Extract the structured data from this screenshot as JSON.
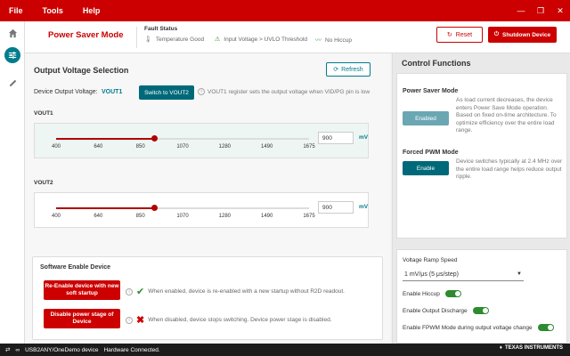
{
  "menu": {
    "file": "File",
    "tools": "Tools",
    "help": "Help"
  },
  "window": {
    "minimize": "—",
    "restore": "❐",
    "close": "✕"
  },
  "header": {
    "mode_title": "Power Saver Mode",
    "fault_title": "Fault Status",
    "faults": [
      {
        "label": "Temperature Good",
        "icon": "thermometer-icon"
      },
      {
        "label": "Input Voltage > UVLO Threshold",
        "icon": "warning-icon"
      },
      {
        "label": "No Hiccup",
        "icon": "wave-icon"
      }
    ],
    "reset_label": "Reset",
    "shutdown_label": "Shutdown Device"
  },
  "output": {
    "title": "Output Voltage Selection",
    "refresh_label": "Refresh",
    "device_output_label": "Device Output Voltage:",
    "device_output_value": "VOUT1",
    "switch_label": "Switch to VOUT2",
    "switch_note": "VOUT1 register sets the output voltage when VID/PG pin is low",
    "ticks": [
      "400",
      "640",
      "850",
      "1070",
      "1280",
      "1490",
      "1675"
    ],
    "unit": "mV",
    "vout1": {
      "label": "VOUT1",
      "value": "900",
      "fraction": 0.39
    },
    "vout2": {
      "label": "VOUT2",
      "value": "900",
      "fraction": 0.39
    }
  },
  "software": {
    "title": "Software Enable Device",
    "reenable_label": "Re-Enable device with new soft startup",
    "reenable_note": "When enabled, device is re-enabled with a new startup without R2D readout.",
    "disable_label": "Disable power stage of Device",
    "disable_note": "When disabled, device stops switching. Device power stage is disabled."
  },
  "control": {
    "title": "Control Functions",
    "psm_title": "Power Saver Mode",
    "psm_button": "Enabled",
    "psm_desc": "As load current decreases, the device enters Power Save Mode operation. Based on fixed on-time architecture. To optimize efficiency over the entire load range.",
    "fpwm_title": "Forced PWM Mode",
    "fpwm_button": "Enable",
    "fpwm_desc": "Device switches typically at 2.4 MHz over the entire load range helps reduce output ripple.",
    "ramp_label": "Voltage Ramp Speed",
    "ramp_value": "1 mV/μs (5 μs/step)",
    "hiccup_label": "Enable Hiccup",
    "discharge_label": "Enable Output Discharge",
    "fpwm_change_label": "Enable FPWM Mode during output voltage change"
  },
  "status": {
    "device": "USB2ANY/OneDemo device",
    "connection": "Hardware Connected.",
    "brand": "TEXAS INSTRUMENTS"
  }
}
